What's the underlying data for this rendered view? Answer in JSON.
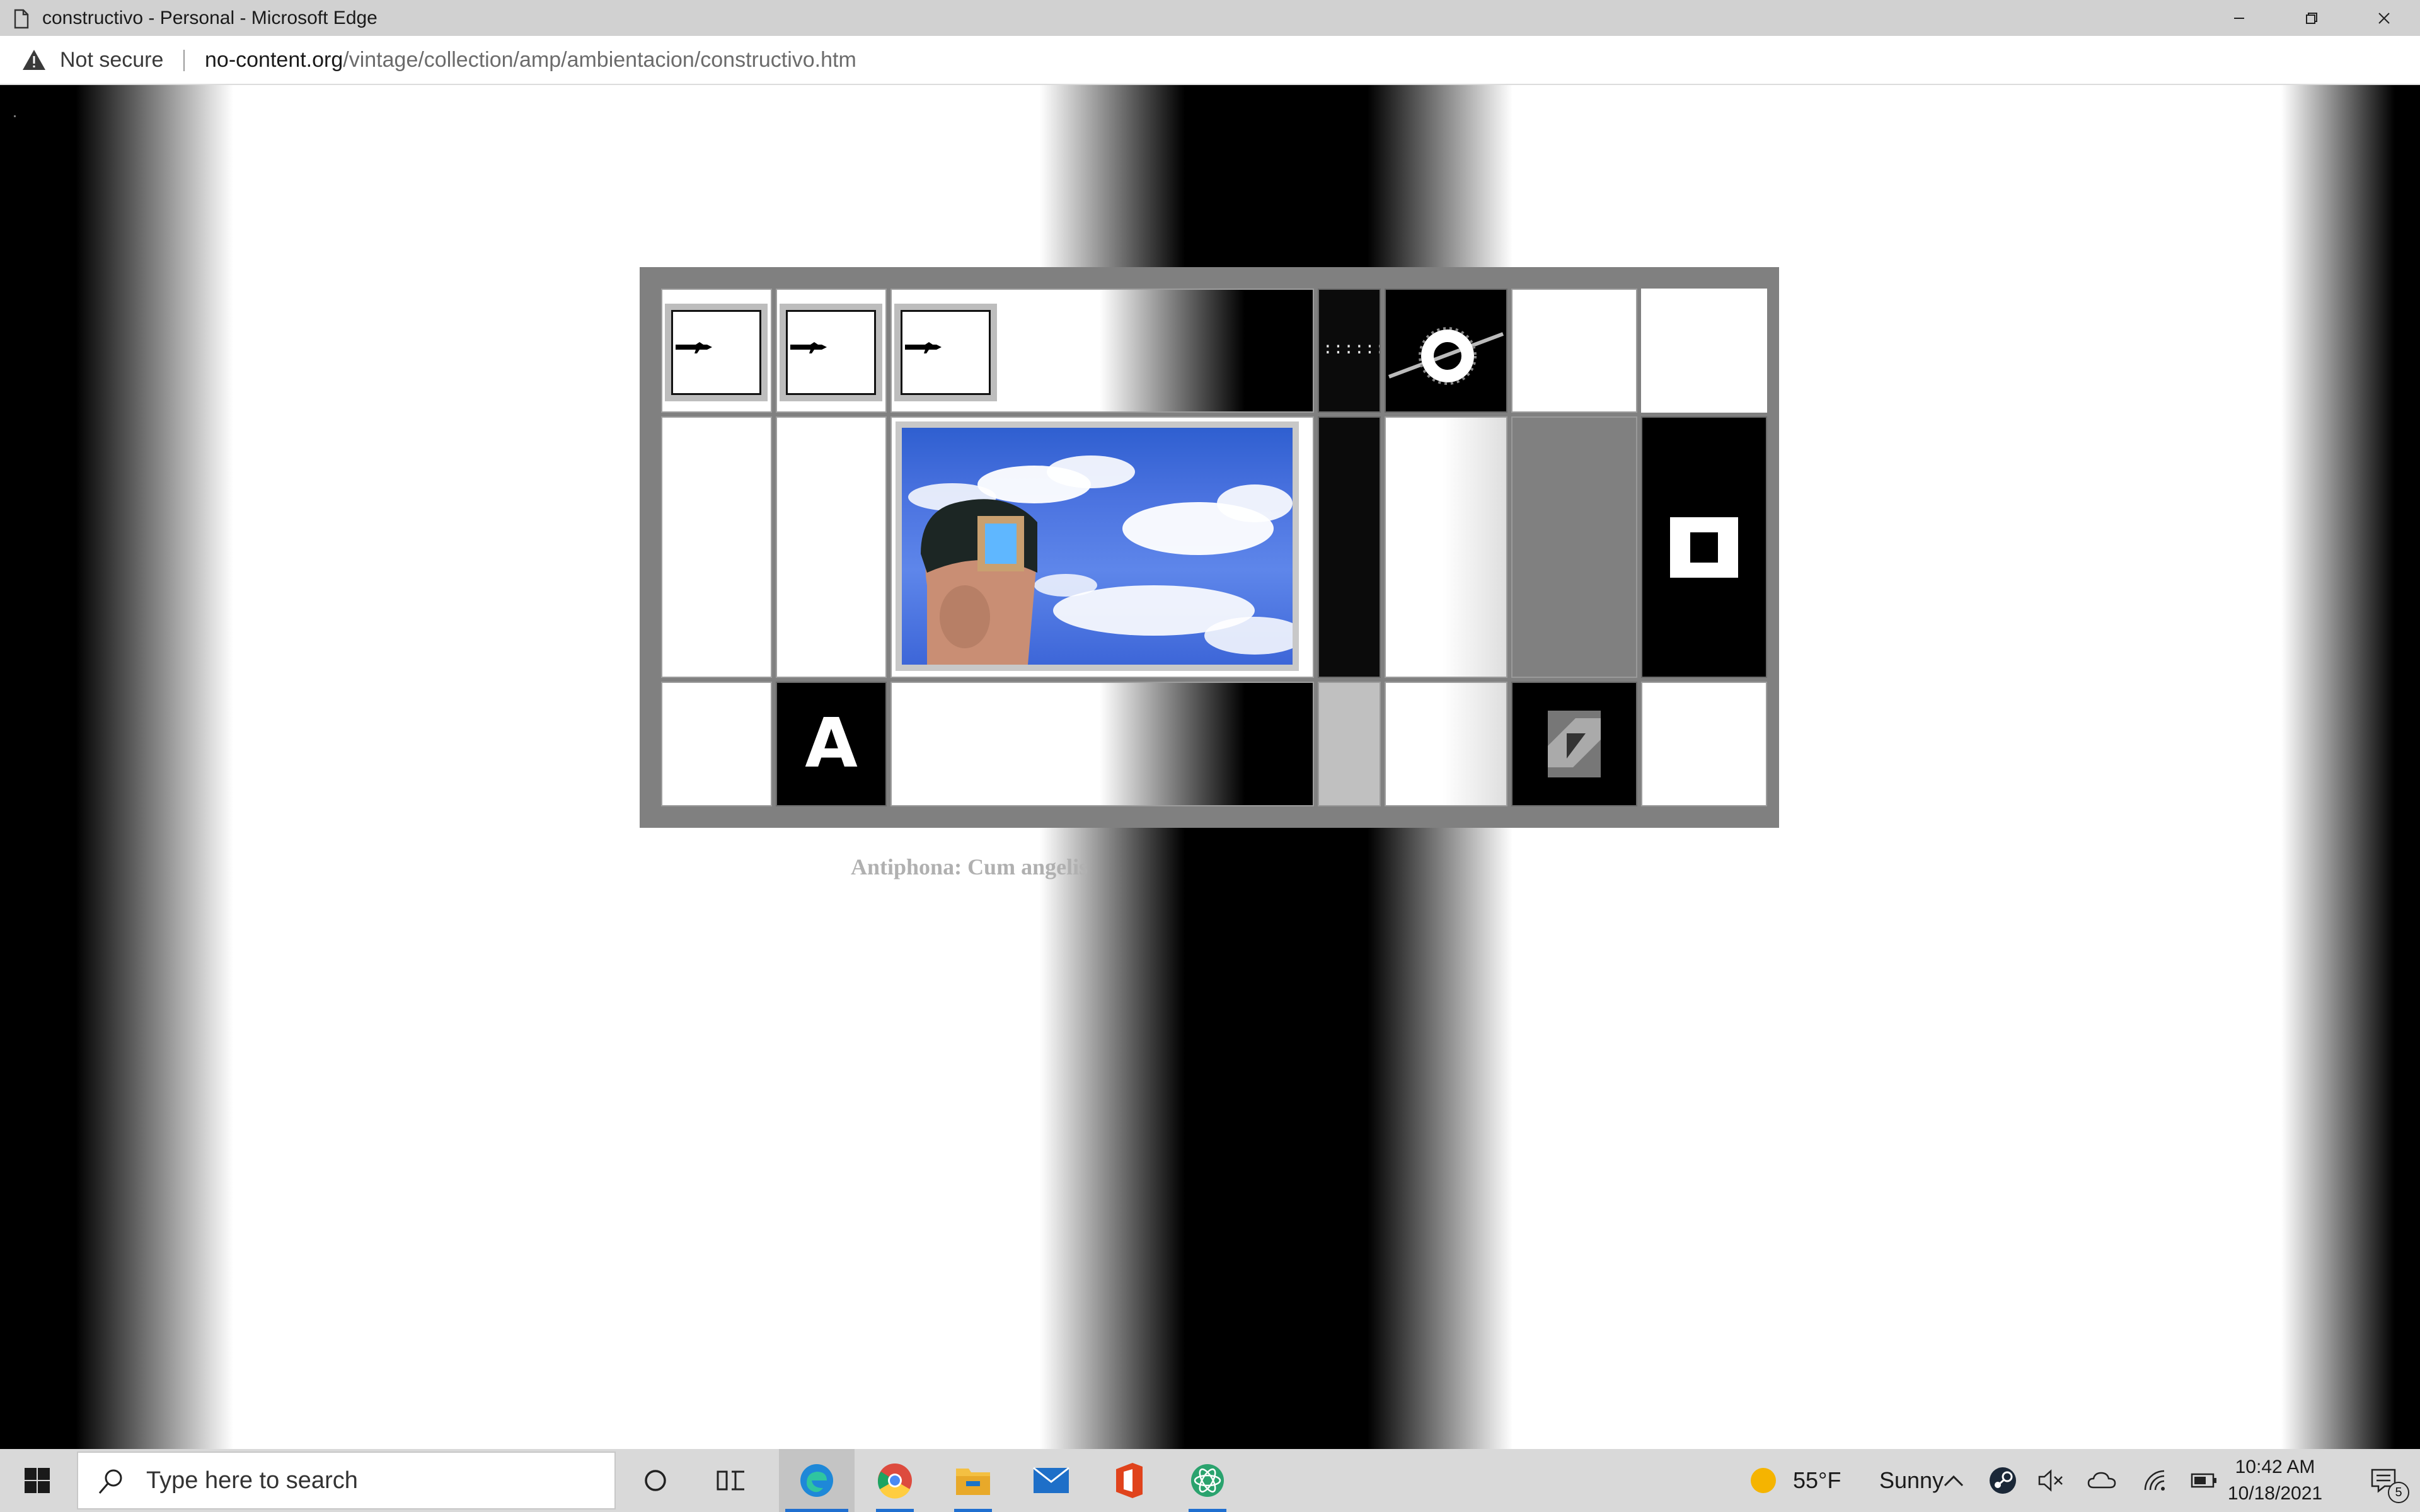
{
  "window": {
    "title": "constructivo - Personal - Microsoft Edge"
  },
  "address_bar": {
    "security_label": "Not secure",
    "url_domain": "no-content.org",
    "url_path": "/vintage/collection/amp/ambientacion/constructivo.htm"
  },
  "page": {
    "caption": "Antiphona: Cum angelis",
    "grid_cells": {
      "dots_text": "::::::::",
      "letter_tile": "A"
    },
    "colors": {
      "frame": "#808080",
      "sky": "#4b73e0"
    }
  },
  "taskbar": {
    "search_placeholder": "Type here to search",
    "weather_temp": "55°F",
    "weather_condition": "Sunny",
    "clock_time": "10:42 AM",
    "clock_date": "10/18/2021",
    "notification_count": "5",
    "pinned_apps": [
      "edge-icon",
      "chrome-icon",
      "file-explorer-icon",
      "mail-icon",
      "office-icon",
      "atom-app-icon"
    ]
  }
}
